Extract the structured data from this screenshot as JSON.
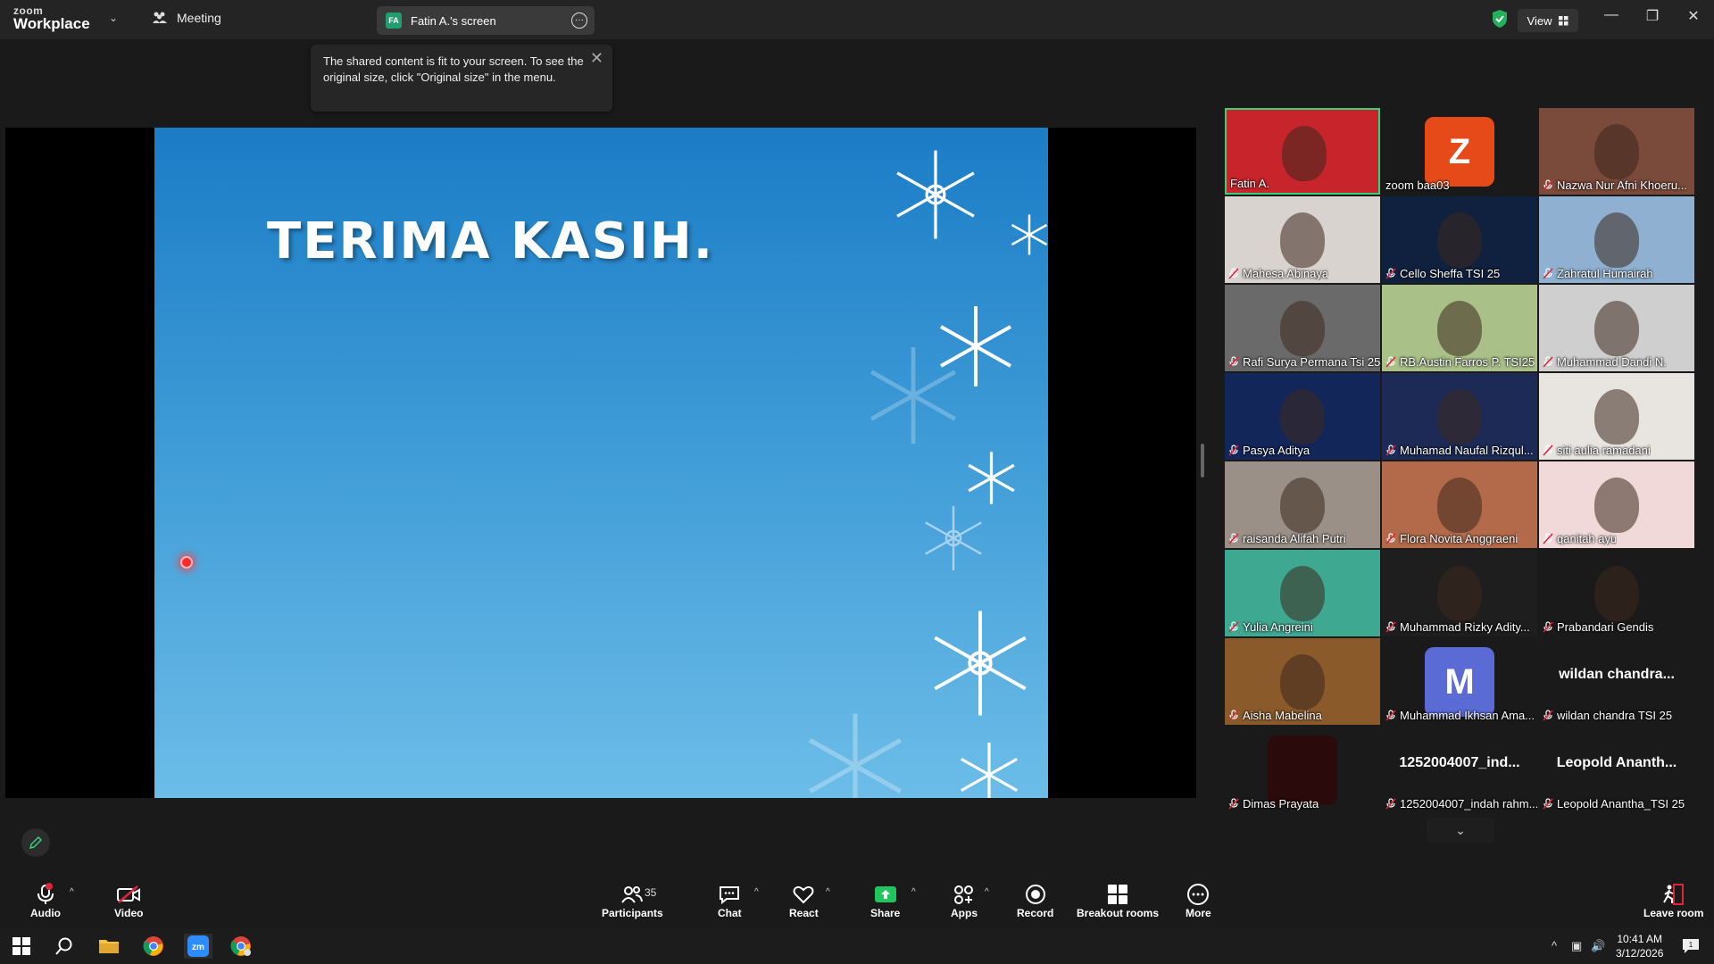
{
  "titlebar": {
    "logo_top": "zoom",
    "logo_bottom": "Workplace",
    "meeting_label": "Meeting",
    "screen_tab_badge": "FA",
    "screen_tab_label": "Fatin A.'s screen",
    "view_label": "View"
  },
  "tooltip": {
    "text": "The shared content is fit to your screen. To see the original size, click \"Original size\" in the menu."
  },
  "slide": {
    "title": "TERIMA KASIH."
  },
  "participants": [
    {
      "name": "Fatin A.",
      "muted": false,
      "type": "video",
      "bg": "#c8242b",
      "active": true
    },
    {
      "name": "zoom baa03",
      "muted": false,
      "type": "avatar",
      "letter": "Z",
      "bg": "#e64a19"
    },
    {
      "name": "Nazwa Nur Afni Khoeru...",
      "muted": true,
      "type": "video",
      "bg": "#7a4a3a"
    },
    {
      "name": "Mahesa Abinaya",
      "muted": true,
      "type": "video",
      "bg": "#d9d3cf"
    },
    {
      "name": "Cello Sheffa TSI 25",
      "muted": true,
      "type": "video",
      "bg": "#10203f"
    },
    {
      "name": "Zahratul Humairah",
      "muted": true,
      "type": "video",
      "bg": "#8fb0d0"
    },
    {
      "name": "Rafi Surya Permana Tsi 25",
      "muted": true,
      "type": "video",
      "bg": "#6a6a6a"
    },
    {
      "name": "RB.Austin Farros P. TSI25",
      "muted": true,
      "type": "video",
      "bg": "#a9c089"
    },
    {
      "name": "Muhammad Dandi N.",
      "muted": true,
      "type": "video",
      "bg": "#cfcfcf"
    },
    {
      "name": "Pasya Aditya",
      "muted": true,
      "type": "video",
      "bg": "#13265a"
    },
    {
      "name": "Muhamad Naufal Rizqul...",
      "muted": true,
      "type": "video",
      "bg": "#1c2a55"
    },
    {
      "name": "siti aulia ramadani",
      "muted": true,
      "type": "video",
      "bg": "#e8e4e0"
    },
    {
      "name": "raisanda Alifah Putri",
      "muted": true,
      "type": "video",
      "bg": "#9a9088"
    },
    {
      "name": "Flora Novita Anggraeni",
      "muted": true,
      "type": "video",
      "bg": "#b36a4a"
    },
    {
      "name": "qanitah ayu",
      "muted": true,
      "type": "video",
      "bg": "#f1d9d9"
    },
    {
      "name": "Yulia Angreini",
      "muted": true,
      "type": "video",
      "bg": "#3ea890"
    },
    {
      "name": "Muhammad Rizky Adity...",
      "muted": true,
      "type": "video",
      "bg": "#1e1e1e"
    },
    {
      "name": "Prabandari Gendis",
      "muted": true,
      "type": "video",
      "bg": "#1a1a1a"
    },
    {
      "name": "Aisha Mabelina",
      "muted": true,
      "type": "video",
      "bg": "#8a5a2a"
    },
    {
      "name": "Muhammad Ikhsan Ama...",
      "muted": true,
      "type": "avatar",
      "letter": "M",
      "bg": "#5b6bd6"
    },
    {
      "name": "wildan chandra TSI 25",
      "muted": true,
      "type": "name",
      "big": "wildan  chandra..."
    },
    {
      "name": "Dimas Prayata",
      "muted": true,
      "type": "avatar",
      "letter": "",
      "bg": "#2a0a0a"
    },
    {
      "name": "1252004007_indah rahm...",
      "muted": true,
      "type": "name",
      "big": "1252004007_ind..."
    },
    {
      "name": "Leopold Anantha_TSI 25",
      "muted": true,
      "type": "name",
      "big": "Leopold  Ananth..."
    }
  ],
  "toolbar": {
    "audio": "Audio",
    "video": "Video",
    "participants": "Participants",
    "participants_count": "35",
    "chat": "Chat",
    "react": "React",
    "share": "Share",
    "apps": "Apps",
    "record": "Record",
    "breakout": "Breakout rooms",
    "more": "More",
    "leave": "Leave room"
  },
  "taskbar": {
    "time": "10:41 AM",
    "date": "3/12/2026",
    "notif_count": "1"
  },
  "colors": {
    "active_border": "#3ad17c",
    "share_green": "#21c55d",
    "muted_red": "#e0243a"
  }
}
